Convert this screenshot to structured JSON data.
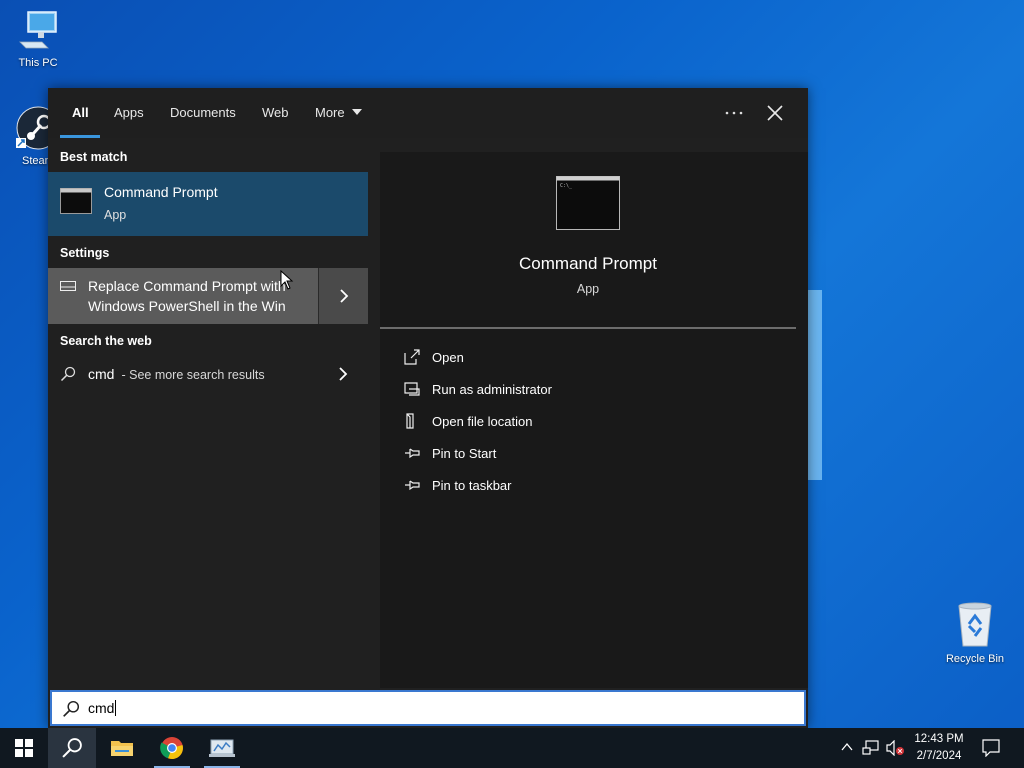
{
  "desktop": {
    "icons": {
      "this_pc": "This PC",
      "steam": "Steam",
      "recycle_bin": "Recycle Bin"
    }
  },
  "search_panel": {
    "tabs": [
      "All",
      "Apps",
      "Documents",
      "Web",
      "More"
    ],
    "active_tab": "All",
    "best_match": {
      "heading": "Best match",
      "title": "Command Prompt",
      "subtitle": "App"
    },
    "settings": {
      "heading": "Settings",
      "line1": "Replace Command Prompt with",
      "line2": "Windows PowerShell in the Win"
    },
    "web": {
      "heading": "Search the web",
      "query": "cmd",
      "suffix": " - See more search results"
    },
    "preview": {
      "title": "Command Prompt",
      "subtitle": "App"
    },
    "actions": [
      "Open",
      "Run as administrator",
      "Open file location",
      "Pin to Start",
      "Pin to taskbar"
    ],
    "search_value": "cmd"
  },
  "taskbar": {
    "time": "12:43 PM",
    "date": "2/7/2024"
  },
  "colors": {
    "accent": "#3a96dd",
    "selection": "#1b4a6b",
    "panel_bg": "#202020"
  }
}
